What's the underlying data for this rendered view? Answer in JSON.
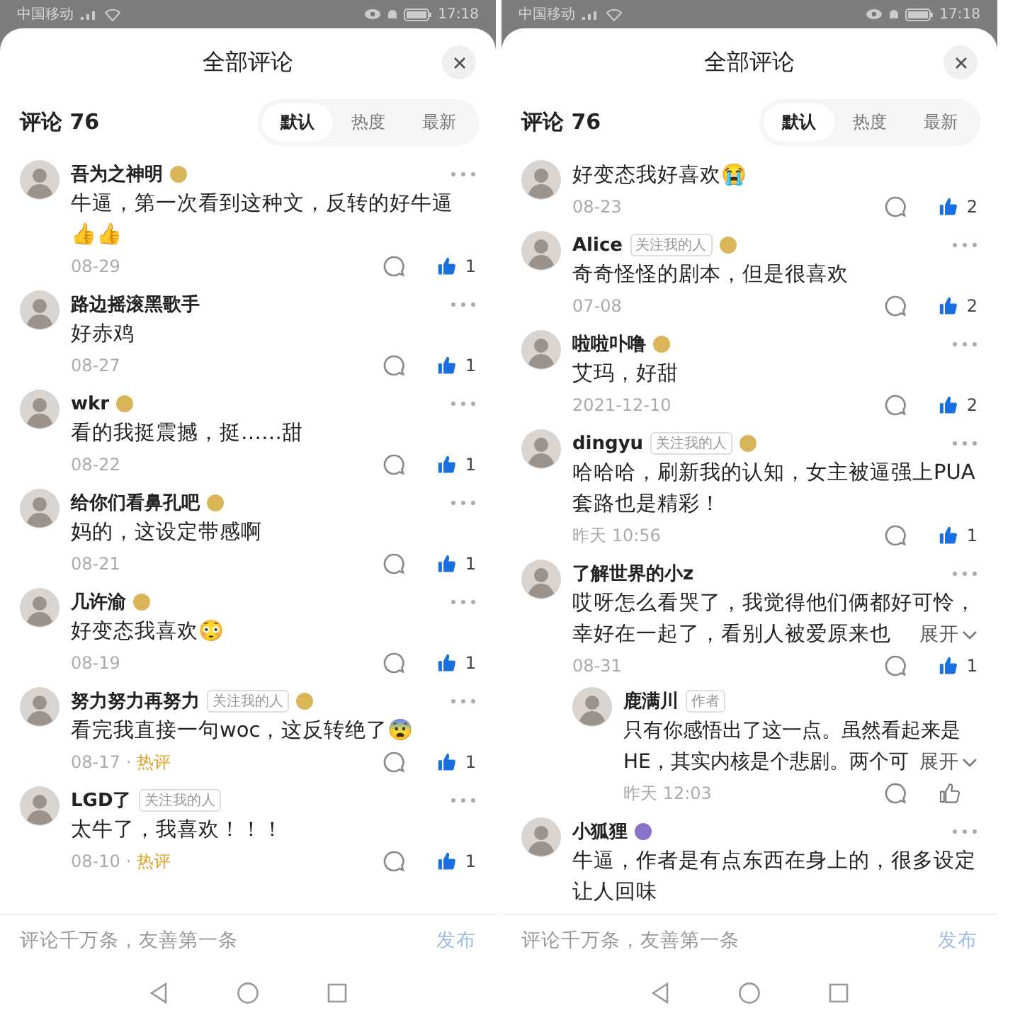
{
  "screens": [
    {
      "status_bar": {
        "carrier": "中国移动",
        "time": "17:18"
      },
      "title": "全部评论",
      "count_label": "评论 76",
      "sort_tabs": [
        {
          "label": "默认",
          "selected": true
        },
        {
          "label": "热度",
          "selected": false
        },
        {
          "label": "最新",
          "selected": false
        }
      ],
      "comments": [
        {
          "name": "吾为之神明",
          "badge": {
            "color": "#d9b65a"
          },
          "text": "牛逼，第一次看到这种文，反转的好牛逼👍👍",
          "date": "08-29",
          "liked": true,
          "likes": "1"
        },
        {
          "name": "路边摇滚黑歌手",
          "text": "好赤鸡",
          "date": "08-27",
          "liked": true,
          "likes": "1"
        },
        {
          "name": "wkr",
          "badge": {
            "color": "#d9b65a"
          },
          "text": "看的我挺震撼，挺……甜",
          "date": "08-22",
          "liked": true,
          "likes": "1"
        },
        {
          "name": "给你们看鼻孔吧",
          "badge": {
            "color": "#d9b65a"
          },
          "text": "妈的，这设定带感啊",
          "date": "08-21",
          "liked": true,
          "likes": "1"
        },
        {
          "name": "几许渝",
          "badge": {
            "color": "#d9b65a"
          },
          "text": "好变态我喜欢😳",
          "date": "08-19",
          "liked": true,
          "likes": "1"
        },
        {
          "name": "努力努力再努力",
          "tag": "关注我的人",
          "badge": {
            "color": "#d9b65a"
          },
          "text": "看完我直接一句woc，这反转绝了😨",
          "date": "08-17",
          "separator": "·",
          "hot": "热评",
          "liked": true,
          "likes": "1"
        },
        {
          "name": "LGD了",
          "tag": "关注我的人",
          "text": "太牛了，我喜欢！！！",
          "date": "08-10",
          "separator": "·",
          "hot": "热评",
          "liked": true,
          "likes": "1"
        }
      ],
      "input": {
        "placeholder": "评论千万条，友善第一条"
      },
      "send_button": "发布"
    },
    {
      "status_bar": {
        "carrier": "中国移动",
        "time": "17:18"
      },
      "title": "全部评论",
      "count_label": "评论 76",
      "sort_tabs": [
        {
          "label": "默认",
          "selected": true
        },
        {
          "label": "热度",
          "selected": false
        },
        {
          "label": "最新",
          "selected": false
        }
      ],
      "comments": [
        {
          "text": "好变态我好喜欢😭",
          "date": "08-23",
          "liked": true,
          "likes": "2"
        },
        {
          "name": "Alice",
          "tag": "关注我的人",
          "badge": {
            "color": "#d9b65a"
          },
          "text": "奇奇怪怪的剧本，但是很喜欢",
          "date": "07-08",
          "liked": true,
          "likes": "2"
        },
        {
          "name": "啦啦卟噜",
          "badge": {
            "color": "#d9b65a"
          },
          "text": "艾玛，好甜",
          "date": "2021-12-10",
          "liked": true,
          "likes": "2"
        },
        {
          "name": "dingyu",
          "tag": "关注我的人",
          "badge": {
            "color": "#d9b65a"
          },
          "text": "哈哈哈，刷新我的认知，女主被逼强上PUA套路也是精彩！",
          "date": "昨天 10:56",
          "liked": true,
          "likes": "1"
        },
        {
          "name": "了解世界的小z",
          "text_lines": [
            "哎呀怎么看哭了，我觉得他们俩都好可怜，",
            "幸好在一起了，看别人被爱原来也"
          ],
          "expand": "展开",
          "date": "08-31",
          "liked": true,
          "likes": "1",
          "replies": [
            {
              "name": "鹿满川",
              "tag": "作者",
              "text_lines": [
                "只有你感悟出了这一点。虽然看起来是",
                "HE，其实内核是个悲剧。两个可"
              ],
              "expand": "展开",
              "date": "昨天 12:03",
              "liked": false
            }
          ]
        },
        {
          "name": "小狐狸",
          "badge": {
            "color": "#8a72c8"
          },
          "text": "牛逼，作者是有点东西在身上的，很多设定让人回味"
        }
      ],
      "input": {
        "placeholder": "评论千万条，友善第一条"
      },
      "send_button": "发布"
    }
  ]
}
